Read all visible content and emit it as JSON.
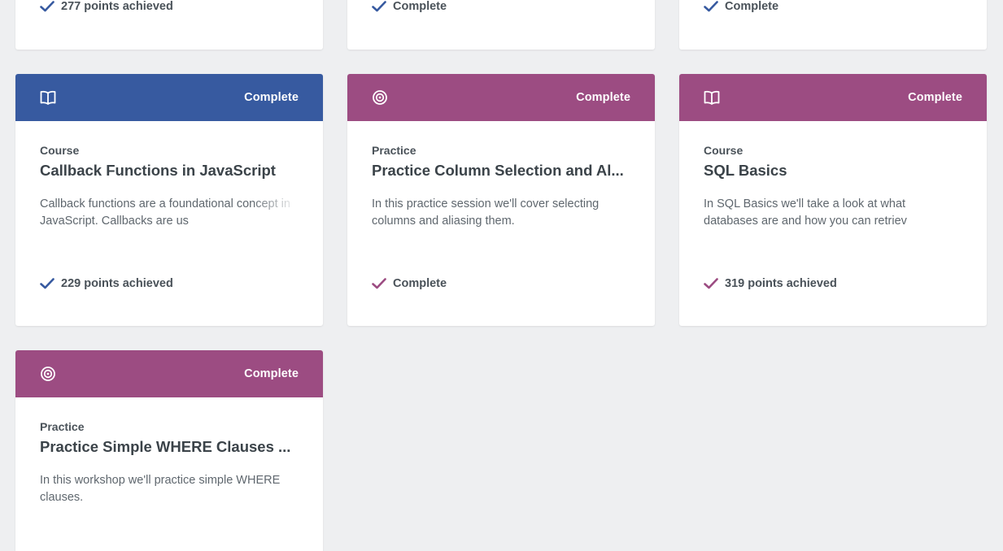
{
  "colors": {
    "blue": "#375aa0",
    "purple": "#9c4c82",
    "page_bg": "#eeeff1"
  },
  "top_row": [
    {
      "footer": "277 points achieved",
      "check_color": "blue"
    },
    {
      "footer": "Complete",
      "check_color": "blue"
    },
    {
      "footer": "Complete",
      "check_color": "blue"
    }
  ],
  "cards": [
    {
      "header_color": "blue",
      "icon": "book-icon",
      "status": "Complete",
      "kind": "Course",
      "title": "Callback Functions in JavaScript",
      "description": "Callback functions are a foundational concept in JavaScript. Callbacks are us",
      "footer": "229 points achieved"
    },
    {
      "header_color": "purple",
      "icon": "target-icon",
      "status": "Complete",
      "kind": "Practice",
      "title": "Practice Column Selection and Al...",
      "description": "In this practice session we'll cover selecting columns and aliasing them.",
      "footer": "Complete"
    },
    {
      "header_color": "purple",
      "icon": "book-icon",
      "status": "Complete",
      "kind": "Course",
      "title": "SQL Basics",
      "description": "In SQL Basics we'll take a look at what databases are and how you can retriev",
      "footer": "319 points achieved"
    },
    {
      "header_color": "purple",
      "icon": "target-icon",
      "status": "Complete",
      "kind": "Practice",
      "title": "Practice Simple WHERE Clauses ...",
      "description": "In this workshop we'll practice simple WHERE clauses."
    }
  ]
}
